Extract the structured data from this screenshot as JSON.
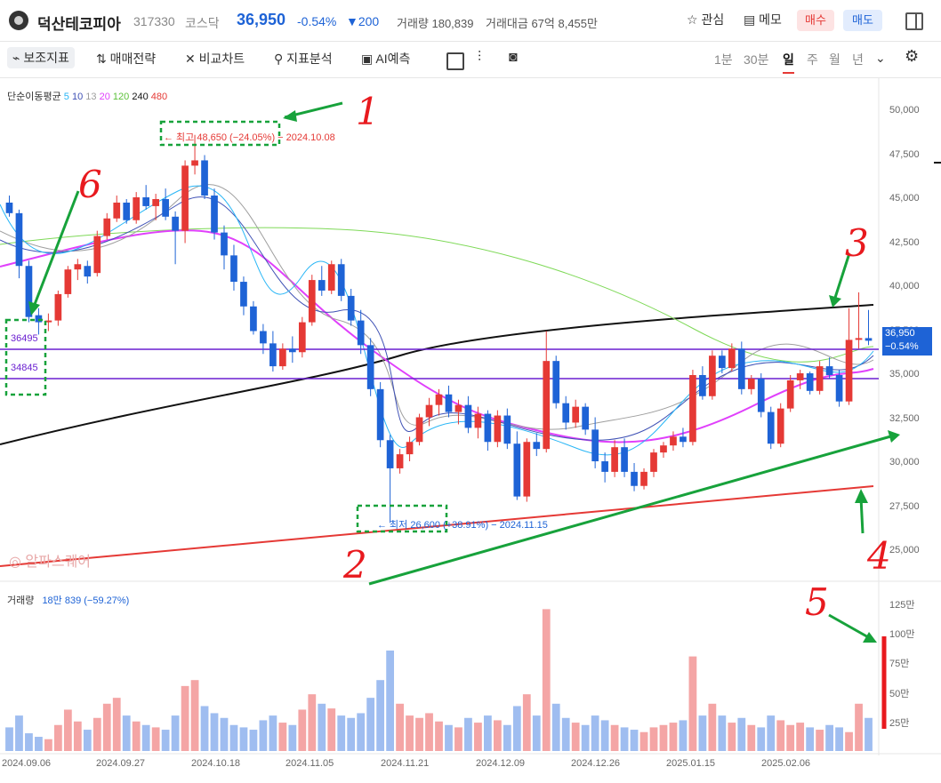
{
  "header": {
    "name": "덕산테코피아",
    "code": "317330",
    "market": "코스닥",
    "price": "36,950",
    "change_pct": "-0.54%",
    "change": "▼200",
    "volume": "거래량 180,839",
    "amount": "거래대금 67억 8,455만",
    "watch_label": "관심",
    "memo_label": "메모",
    "buy_label": "매수",
    "sell_label": "매도"
  },
  "toolbar": {
    "items": [
      "보조지표",
      "매매전략",
      "비교차트",
      "지표분석",
      "AI예측"
    ],
    "periods": [
      "1분",
      "30분",
      "일",
      "주",
      "월",
      "년"
    ],
    "active_period": "일"
  },
  "legend": {
    "ma_title": "단순이동평균",
    "ma_periods": [
      "5",
      "10",
      "13",
      "20",
      "120",
      "240",
      "480"
    ],
    "ma_colors": [
      "#29b6f6",
      "#3f51b5",
      "#9e9e9e",
      "#e040fb",
      "#7ed957",
      "#111111",
      "#e53935"
    ]
  },
  "annotations": {
    "high": "← 최고 48,650 (−24.05%) − 2024.10.08",
    "low": "← 최저 26,600 (+38.91%) − 2024.11.15",
    "level1": "36495",
    "level2": "34845",
    "marks": [
      "1",
      "2",
      "3",
      "4",
      "5",
      "6"
    ]
  },
  "price_axis": [
    "50,000",
    "47,500",
    "45,000",
    "42,500",
    "40,000",
    "37,500",
    "35,000",
    "32,500",
    "30,000",
    "27,500",
    "25,000"
  ],
  "current_price_tag": {
    "price": "36,950",
    "change": "−0.54%"
  },
  "watermark": "알파스퀘어",
  "volume_panel": {
    "title": "거래량",
    "value": "18만 839 (−59.27%)",
    "axis": [
      "125만",
      "100만",
      "75만",
      "50만",
      "25만"
    ]
  },
  "date_axis": [
    "2024.09.06",
    "2024.09.27",
    "2024.10.18",
    "2024.11.05",
    "2024.11.21",
    "2024.12.09",
    "2024.12.26",
    "2025.01.15",
    "2025.02.06"
  ],
  "chart_data": {
    "type": "candlestick",
    "up_color": "#e53935",
    "down_color": "#1e63d6",
    "candles": [
      [
        44800,
        45200,
        44000,
        44200
      ],
      [
        44200,
        44400,
        40500,
        41200
      ],
      [
        41200,
        41500,
        38000,
        38300
      ],
      [
        38400,
        38800,
        37300,
        38000
      ],
      [
        38000,
        38500,
        37500,
        38100
      ],
      [
        38100,
        39800,
        37800,
        39600
      ],
      [
        39600,
        41200,
        39400,
        41000
      ],
      [
        41000,
        41600,
        40400,
        41300
      ],
      [
        41200,
        41500,
        40200,
        40600
      ],
      [
        40800,
        43200,
        40600,
        42900
      ],
      [
        42900,
        44200,
        42700,
        43900
      ],
      [
        43900,
        45200,
        43700,
        44800
      ],
      [
        44800,
        45000,
        43600,
        43800
      ],
      [
        43800,
        45400,
        43600,
        45100
      ],
      [
        45100,
        45800,
        44400,
        44600
      ],
      [
        44600,
        45300,
        43800,
        45000
      ],
      [
        45000,
        45600,
        43800,
        44000
      ],
      [
        44000,
        44300,
        41300,
        43200
      ],
      [
        43200,
        47200,
        42500,
        46900
      ],
      [
        46900,
        48650,
        46400,
        47200
      ],
      [
        47200,
        47500,
        45000,
        45200
      ],
      [
        45200,
        45600,
        42700,
        43100
      ],
      [
        43100,
        43500,
        41000,
        41800
      ],
      [
        41800,
        42400,
        39800,
        40300
      ],
      [
        40300,
        40600,
        38400,
        38900
      ],
      [
        38900,
        39200,
        37300,
        37500
      ],
      [
        37500,
        37900,
        36200,
        36800
      ],
      [
        36800,
        37500,
        35200,
        35500
      ],
      [
        35500,
        36800,
        35300,
        36500
      ],
      [
        36500,
        37200,
        35700,
        36300
      ],
      [
        36300,
        38300,
        36000,
        38000
      ],
      [
        38000,
        40700,
        37800,
        40400
      ],
      [
        40400,
        41200,
        39500,
        39800
      ],
      [
        39800,
        41500,
        39600,
        41300
      ],
      [
        41300,
        41600,
        39200,
        39500
      ],
      [
        39500,
        39900,
        37800,
        38100
      ],
      [
        38100,
        38700,
        36200,
        36700
      ],
      [
        36700,
        37100,
        33800,
        34200
      ],
      [
        34200,
        34600,
        30900,
        31300
      ],
      [
        31300,
        31600,
        26600,
        29700
      ],
      [
        29700,
        30800,
        29400,
        30500
      ],
      [
        30500,
        31500,
        30100,
        31200
      ],
      [
        31200,
        32800,
        31000,
        32600
      ],
      [
        32600,
        33700,
        32100,
        33300
      ],
      [
        33300,
        34200,
        32700,
        33900
      ],
      [
        33900,
        34400,
        32600,
        32900
      ],
      [
        32900,
        33600,
        32200,
        33300
      ],
      [
        33300,
        33800,
        31700,
        32000
      ],
      [
        32000,
        33200,
        31400,
        32800
      ],
      [
        32800,
        33000,
        30700,
        31200
      ],
      [
        31200,
        33000,
        30900,
        32700
      ],
      [
        32700,
        33100,
        30800,
        31100
      ],
      [
        31100,
        31800,
        27900,
        28100
      ],
      [
        28100,
        31400,
        27800,
        31200
      ],
      [
        31200,
        31700,
        30400,
        30800
      ],
      [
        30800,
        37500,
        30600,
        35800
      ],
      [
        35800,
        36100,
        33100,
        33400
      ],
      [
        33400,
        33800,
        31900,
        32300
      ],
      [
        32300,
        33600,
        32000,
        33200
      ],
      [
        33200,
        33400,
        31600,
        31900
      ],
      [
        31900,
        32600,
        29700,
        30100
      ],
      [
        30100,
        30600,
        28900,
        29500
      ],
      [
        29500,
        31300,
        29200,
        30900
      ],
      [
        30900,
        31400,
        29200,
        29500
      ],
      [
        29500,
        30000,
        28400,
        28700
      ],
      [
        28700,
        29700,
        28500,
        29500
      ],
      [
        29500,
        30800,
        29200,
        30600
      ],
      [
        30600,
        31200,
        30300,
        31000
      ],
      [
        31000,
        31800,
        30700,
        31500
      ],
      [
        31500,
        32000,
        30900,
        31200
      ],
      [
        31200,
        35300,
        31000,
        35000
      ],
      [
        35000,
        35500,
        33600,
        33800
      ],
      [
        33800,
        36400,
        33600,
        36100
      ],
      [
        36100,
        36400,
        35100,
        35400
      ],
      [
        35400,
        36800,
        35200,
        36500
      ],
      [
        36500,
        36900,
        33900,
        34200
      ],
      [
        34200,
        35000,
        33900,
        34800
      ],
      [
        34800,
        35100,
        32600,
        32900
      ],
      [
        32900,
        33200,
        30800,
        31100
      ],
      [
        31100,
        33400,
        30900,
        33100
      ],
      [
        33100,
        35000,
        32900,
        34700
      ],
      [
        34700,
        35300,
        34200,
        35100
      ],
      [
        35100,
        35200,
        33900,
        34100
      ],
      [
        34100,
        35800,
        33900,
        35500
      ],
      [
        35500,
        36000,
        34800,
        35000
      ],
      [
        35000,
        35300,
        33200,
        33500
      ],
      [
        33500,
        38800,
        33300,
        37000
      ],
      [
        37000,
        39700,
        36500,
        37100
      ],
      [
        37100,
        38700,
        36700,
        36950
      ]
    ],
    "volume": [
      20,
      30,
      15,
      12,
      10,
      22,
      35,
      25,
      18,
      28,
      40,
      45,
      30,
      25,
      22,
      20,
      18,
      30,
      55,
      60,
      38,
      32,
      28,
      22,
      20,
      18,
      26,
      30,
      24,
      22,
      35,
      48,
      40,
      36,
      30,
      28,
      32,
      45,
      60,
      85,
      40,
      30,
      28,
      32,
      25,
      22,
      20,
      28,
      24,
      30,
      26,
      22,
      38,
      48,
      30,
      120,
      40,
      28,
      24,
      22,
      30,
      26,
      22,
      20,
      18,
      16,
      20,
      22,
      24,
      26,
      80,
      30,
      40,
      30,
      24,
      28,
      22,
      20,
      30,
      26,
      22,
      24,
      20,
      18,
      22,
      20,
      16,
      40,
      28,
      18
    ]
  }
}
